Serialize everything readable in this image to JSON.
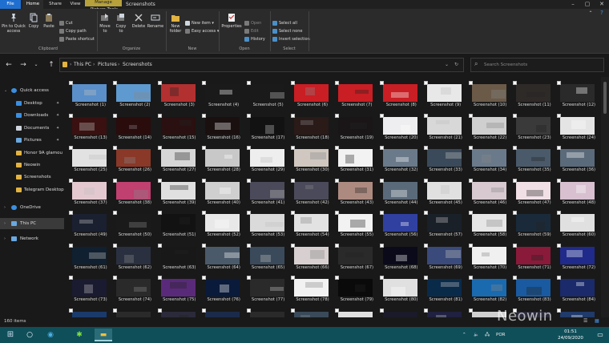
{
  "titlebar": {
    "tabs": [
      "File",
      "Home",
      "Share",
      "View",
      "Picture Tools"
    ],
    "manage_label": "Manage",
    "window_title": "Screenshots"
  },
  "ribbon": {
    "clipboard": {
      "pin_label": "Pin to Quick access",
      "copy_label": "Copy",
      "paste_label": "Paste",
      "cut_label": "Cut",
      "copy_path_label": "Copy path",
      "paste_shortcut_label": "Paste shortcut",
      "group_label": "Clipboard"
    },
    "organize": {
      "move_to_label": "Move to",
      "copy_to_label": "Copy to",
      "delete_label": "Delete",
      "rename_label": "Rename",
      "group_label": "Organize"
    },
    "new": {
      "new_folder_label": "New folder",
      "new_item_label": "New item",
      "easy_access_label": "Easy access",
      "group_label": "New"
    },
    "open": {
      "properties_label": "Properties",
      "open_label": "Open",
      "edit_label": "Edit",
      "history_label": "History",
      "group_label": "Open"
    },
    "select": {
      "select_all_label": "Select all",
      "select_none_label": "Select none",
      "invert_selection_label": "Invert selection",
      "group_label": "Select"
    }
  },
  "address": {
    "crumbs": [
      "This PC",
      "Pictures",
      "Screenshots"
    ],
    "search_placeholder": "Search Screenshots"
  },
  "nav": {
    "quick_access": "Quick access",
    "items": [
      {
        "label": "Desktop",
        "pinned": true
      },
      {
        "label": "Downloads",
        "pinned": true
      },
      {
        "label": "Documents",
        "pinned": true
      },
      {
        "label": "Pictures",
        "pinned": true
      },
      {
        "label": "Honor 9A glamou",
        "pinned": false
      },
      {
        "label": "Neowin",
        "pinned": false
      },
      {
        "label": "Screenshots",
        "pinned": false
      },
      {
        "label": "Telegram Desktop",
        "pinned": false
      }
    ],
    "onedrive": "OneDrive",
    "thispc": "This PC",
    "network": "Network"
  },
  "files": {
    "prefix": "Screenshot",
    "visible_rows": 8,
    "columns": 12,
    "thumb_colors": [
      [
        "#5a8fc9",
        "#5e9ad0",
        "#b33030",
        "#1a1a1a",
        "#1a1a1a",
        "#c91e24",
        "#c91e24",
        "#c91e24",
        "#e8e8e8",
        "#6b5a48",
        "#2e2a28",
        "#2a2a2a"
      ],
      [
        "#3a1010",
        "#2a0c0c",
        "#2a1010",
        "#1a1010",
        "#121212",
        "#2a1a18",
        "#1a1618",
        "#eeeef0",
        "#d8d8d8",
        "#cfcfcf",
        "#3a3a3a",
        "#e4e4e4"
      ],
      [
        "#e2e2e2",
        "#8a3828",
        "#d6d6d6",
        "#c8c8c8",
        "#eeeeee",
        "#d0c8c0",
        "#f2f2f2",
        "#6a7a8a",
        "#3a4a5a",
        "#6a7a8a",
        "#4a5a6a",
        "#5a6a7a"
      ],
      [
        "#e4c8d0",
        "#c04070",
        "#e0e0e0",
        "#cfcfcf",
        "#4a4a5a",
        "#4a4a5a",
        "#ad8a80",
        "#5a6a7a",
        "#e0e0e0",
        "#d8c8d0",
        "#f0e0e6",
        "#d8c0d0"
      ],
      [
        "#1a2030",
        "#1a1a1a",
        "#121212",
        "#e8e8e8",
        "#dadada",
        "#e2e2e2",
        "#f2f2f2",
        "#3040a0",
        "#1a2028",
        "#e6e6e6",
        "#1a2a3a",
        "#e0e0e0"
      ],
      [
        "#102030",
        "#2a3040",
        "#181818",
        "#4a5a6a",
        "#3a4a5a",
        "#d8d0d0",
        "#2a2a2a",
        "#0a0a1a",
        "#3a4a7a",
        "#f0f0f0",
        "#8a1a3a",
        "#202a8a"
      ],
      [
        "#1a1a30",
        "#2a2a2a",
        "#5a2a7a",
        "#0a1a3a",
        "#2a2a2a",
        "#f2f2f2",
        "#0a0a0a",
        "#e0e0e0",
        "#0a2a4a",
        "#1a6ab0",
        "#1a5aa0",
        "#1a2a6a"
      ],
      [
        "#1a3a6a",
        "#2a2a2a",
        "#2a2a3a",
        "#1a2a4a",
        "#2a2a2a",
        "#3a4a5a",
        "#e0e0e0",
        "#1a1a2a",
        "#202040",
        "#d0d0d0",
        "#2a2a3a",
        "#203a6a"
      ]
    ]
  },
  "status": {
    "count": "160 items"
  },
  "taskbar": {
    "tray_lang": "POR",
    "time": "01:51",
    "date": "24/09/2020"
  },
  "watermark": "Neowin"
}
